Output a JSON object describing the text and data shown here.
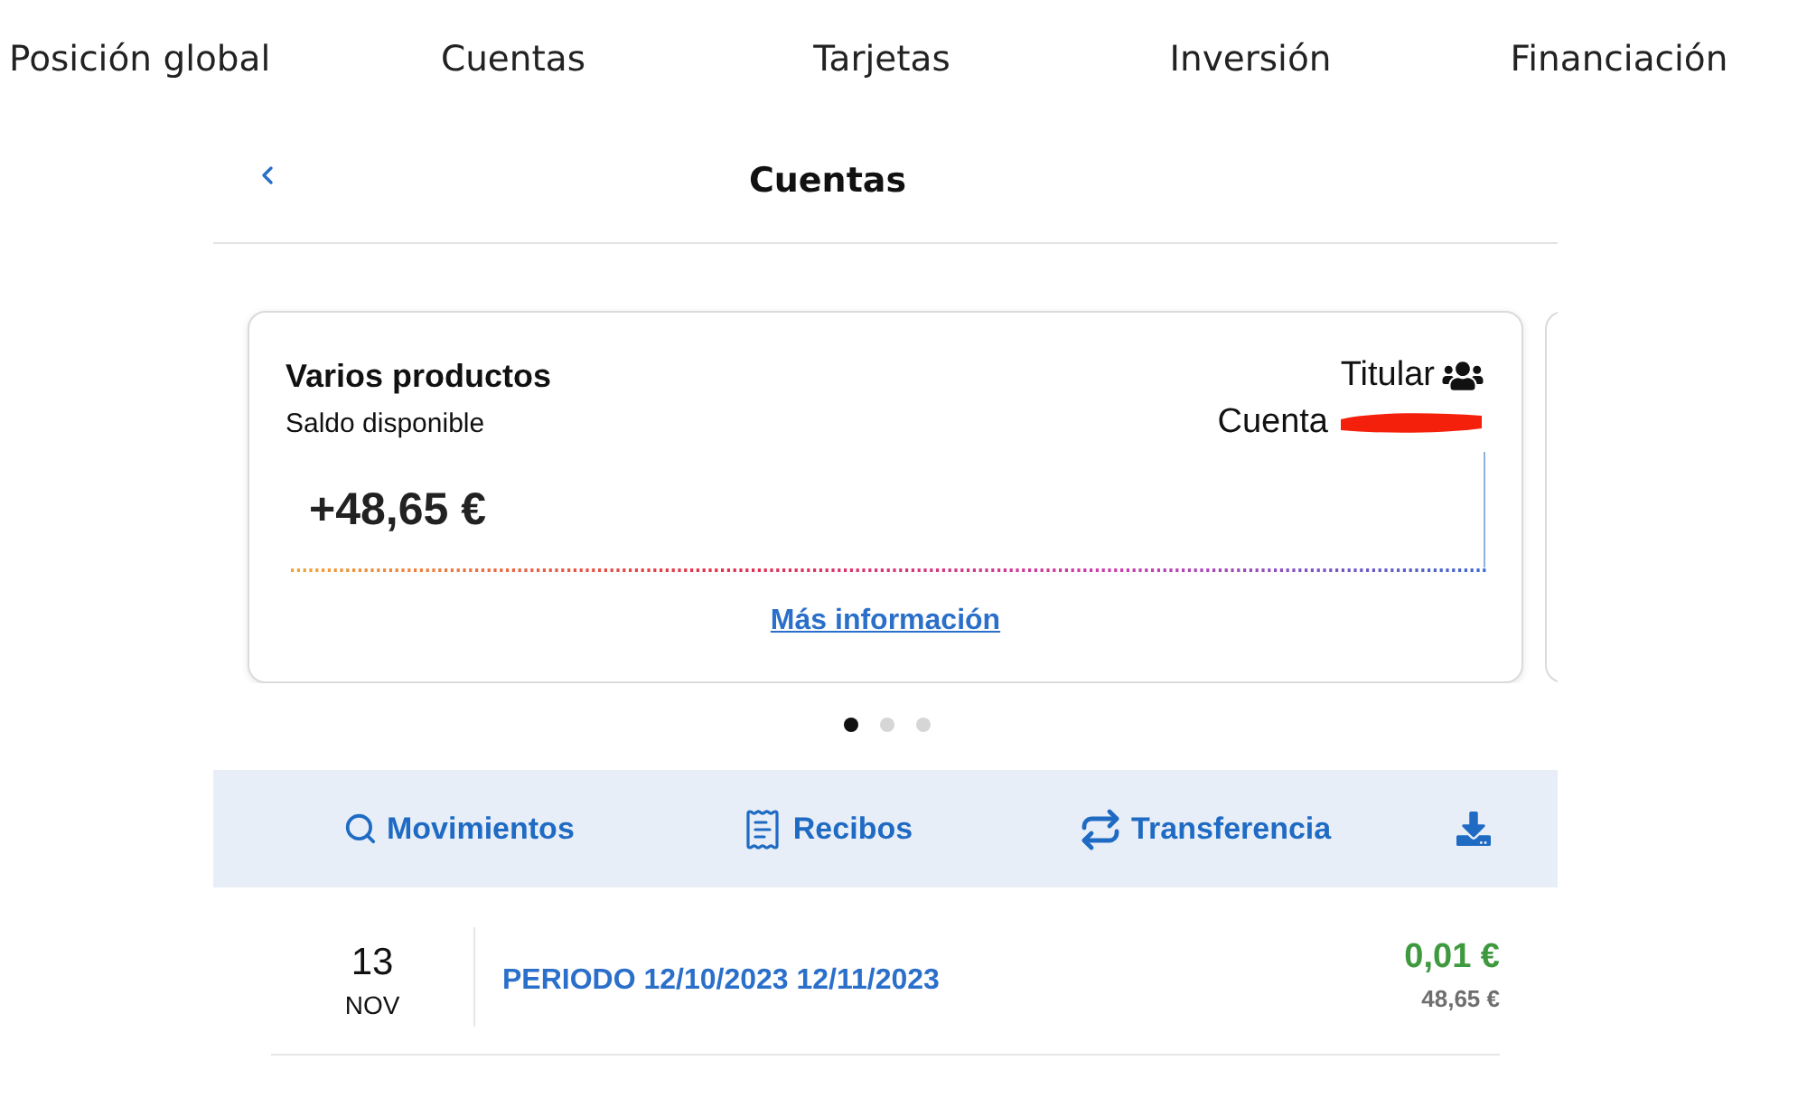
{
  "nav_tabs": [
    {
      "label": "Posición global"
    },
    {
      "label": "Cuentas"
    },
    {
      "label": "Tarjetas"
    },
    {
      "label": "Inversión"
    },
    {
      "label": "Financiación"
    }
  ],
  "header": {
    "title": "Cuentas"
  },
  "accounts_carousel": {
    "cards": [
      {
        "product": "Varios productos",
        "balance_label": "Saldo disponible",
        "balance": "+48,65 €",
        "role": "Titular",
        "account_name": "Cuenta",
        "account_name_redacted": true,
        "more_link": "Más información"
      }
    ],
    "dots": [
      {
        "selected": true
      },
      {
        "selected": false
      },
      {
        "selected": false
      }
    ]
  },
  "actions": [
    {
      "kind": "search",
      "label": "Movimientos"
    },
    {
      "kind": "receipt",
      "label": "Recibos"
    },
    {
      "kind": "transfer",
      "label": "Transferencia"
    },
    {
      "kind": "download"
    }
  ],
  "movements": [
    {
      "day": "13",
      "month": "NOV",
      "description": "PERIODO 12/10/2023 12/11/2023",
      "amount": "0,01 €",
      "balance": "48,65 €"
    }
  ]
}
